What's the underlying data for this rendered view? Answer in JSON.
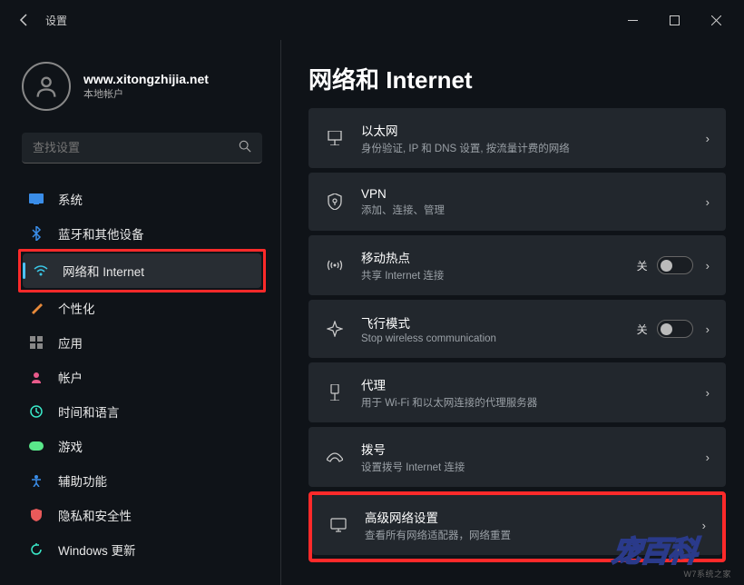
{
  "app": {
    "title": "设置"
  },
  "user": {
    "name": "www.xitongzhijia.net",
    "sub": "本地帐户"
  },
  "search": {
    "placeholder": "查找设置"
  },
  "nav": {
    "items": [
      {
        "label": "系统",
        "active": false
      },
      {
        "label": "蓝牙和其他设备",
        "active": false
      },
      {
        "label": "网络和 Internet",
        "active": true
      },
      {
        "label": "个性化",
        "active": false
      },
      {
        "label": "应用",
        "active": false
      },
      {
        "label": "帐户",
        "active": false
      },
      {
        "label": "时间和语言",
        "active": false
      },
      {
        "label": "游戏",
        "active": false
      },
      {
        "label": "辅助功能",
        "active": false
      },
      {
        "label": "隐私和安全性",
        "active": false
      },
      {
        "label": "Windows 更新",
        "active": false
      }
    ]
  },
  "page": {
    "title": "网络和 Internet"
  },
  "cards": {
    "ethernet": {
      "title": "以太网",
      "sub": "身份验证, IP 和 DNS 设置, 按流量计费的网络"
    },
    "vpn": {
      "title": "VPN",
      "sub": "添加、连接、管理"
    },
    "hotspot": {
      "title": "移动热点",
      "sub": "共享 Internet 连接",
      "toggle_label": "关"
    },
    "airplane": {
      "title": "飞行模式",
      "sub": "Stop wireless communication",
      "toggle_label": "关"
    },
    "proxy": {
      "title": "代理",
      "sub": "用于 Wi-Fi 和以太网连接的代理服务器"
    },
    "dialup": {
      "title": "拨号",
      "sub": "设置拨号 Internet 连接"
    },
    "advanced": {
      "title": "高级网络设置",
      "sub": "查看所有网络适配器，网络重置"
    }
  },
  "stamp": "宠百科",
  "watermark": "W7系统之家"
}
